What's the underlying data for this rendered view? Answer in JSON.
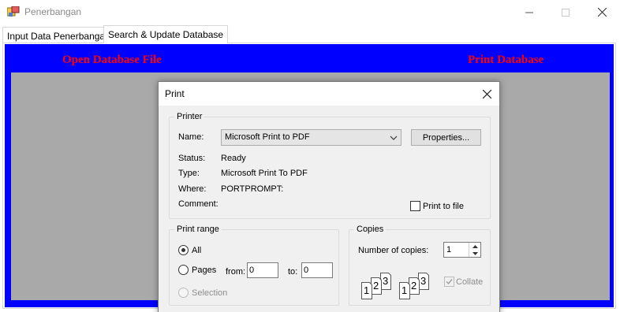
{
  "window": {
    "title": "Penerbangan"
  },
  "tabs": [
    {
      "label": "Input Data Penerbangan"
    },
    {
      "label": "Search & Update Database"
    }
  ],
  "panel": {
    "open_link": "Open Database File",
    "print_link": "Print Database",
    "panel_color": "#0000ff",
    "link_color": "#ff0000"
  },
  "dialog": {
    "title": "Print",
    "printer": {
      "legend": "Printer",
      "name_label": "Name:",
      "name_value": "Microsoft Print to PDF",
      "properties_button": "Properties...",
      "status_label": "Status:",
      "status_value": "Ready",
      "type_label": "Type:",
      "type_value": "Microsoft Print To PDF",
      "where_label": "Where:",
      "where_value": "PORTPROMPT:",
      "comment_label": "Comment:",
      "comment_value": "",
      "print_to_file_label": "Print to file"
    },
    "range": {
      "legend": "Print range",
      "all_label": "All",
      "pages_label": "Pages",
      "from_label": "from:",
      "from_value": "0",
      "to_label": "to:",
      "to_value": "0",
      "selection_label": "Selection"
    },
    "copies": {
      "legend": "Copies",
      "number_label": "Number of copies:",
      "number_value": "1",
      "collate_label": "Collate",
      "page_numbers": [
        "1",
        "2",
        "3"
      ]
    }
  }
}
